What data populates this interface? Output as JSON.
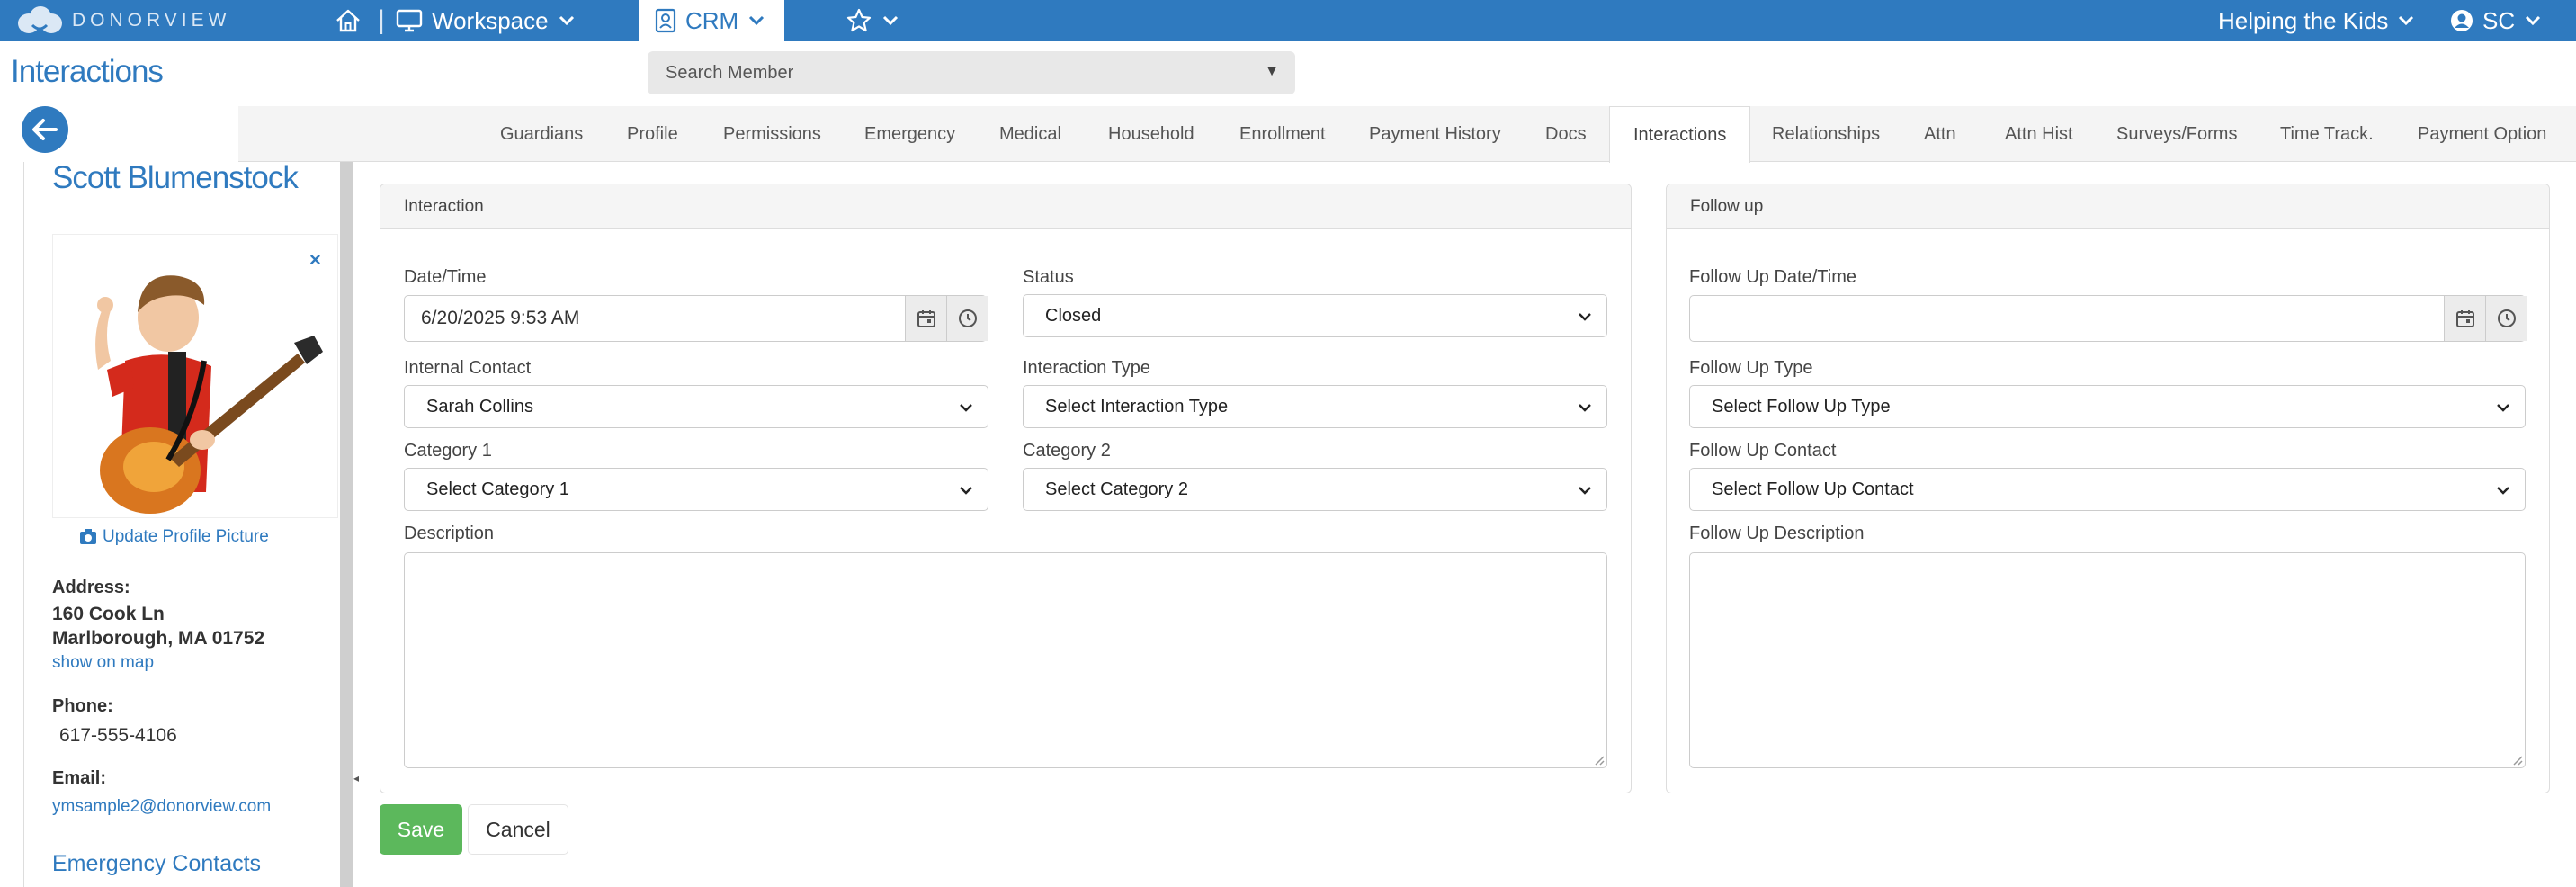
{
  "topbar": {
    "logo_text": "DONORVIEW",
    "workspace_label": "Workspace",
    "crm_label": "CRM",
    "org_name": "Helping the Kids",
    "user_initials": "SC",
    "separator": "|"
  },
  "header": {
    "page_title": "Interactions",
    "member_search_placeholder": "Search Member"
  },
  "tabs": [
    {
      "label": "Guardians"
    },
    {
      "label": "Profile"
    },
    {
      "label": "Permissions"
    },
    {
      "label": "Emergency"
    },
    {
      "label": "Medical"
    },
    {
      "label": "Household"
    },
    {
      "label": "Enrollment"
    },
    {
      "label": "Payment History"
    },
    {
      "label": "Docs"
    },
    {
      "label": "Interactions",
      "active": true
    },
    {
      "label": "Relationships"
    },
    {
      "label": "Attn"
    },
    {
      "label": "Attn Hist"
    },
    {
      "label": "Surveys/Forms"
    },
    {
      "label": "Time Track."
    },
    {
      "label": "Payment Option"
    }
  ],
  "sidebar": {
    "member_name": "Scott Blumenstock",
    "update_picture_label": "Update Profile Picture",
    "close_symbol": "×",
    "address_label": "Address:",
    "address_line1": "160 Cook Ln",
    "address_line2": "Marlborough, MA 01752",
    "show_on_map": "show on map",
    "phone_label": "Phone:",
    "phone": "617-555-4106",
    "email_label": "Email:",
    "email": "ymsample2@donorview.com",
    "emergency_contacts": "Emergency Contacts"
  },
  "interaction": {
    "panel_title": "Interaction",
    "datetime_label": "Date/Time",
    "datetime_value": "6/20/2025 9:53 AM",
    "status_label": "Status",
    "status_value": "Closed",
    "internal_contact_label": "Internal Contact",
    "internal_contact_value": "Sarah Collins",
    "interaction_type_label": "Interaction Type",
    "interaction_type_value": "Select Interaction Type",
    "category1_label": "Category 1",
    "category1_value": "Select Category 1",
    "category2_label": "Category 2",
    "category2_value": "Select Category 2",
    "description_label": "Description"
  },
  "followup": {
    "panel_title": "Follow up",
    "datetime_label": "Follow Up Date/Time",
    "datetime_value": "",
    "type_label": "Follow Up Type",
    "type_value": "Select Follow Up Type",
    "contact_label": "Follow Up Contact",
    "contact_value": "Select Follow Up Contact",
    "description_label": "Follow Up Description"
  },
  "actions": {
    "save_label": "Save",
    "cancel_label": "Cancel"
  },
  "colors": {
    "brand_blue": "#2f7abf",
    "save_green": "#5cb85c"
  }
}
